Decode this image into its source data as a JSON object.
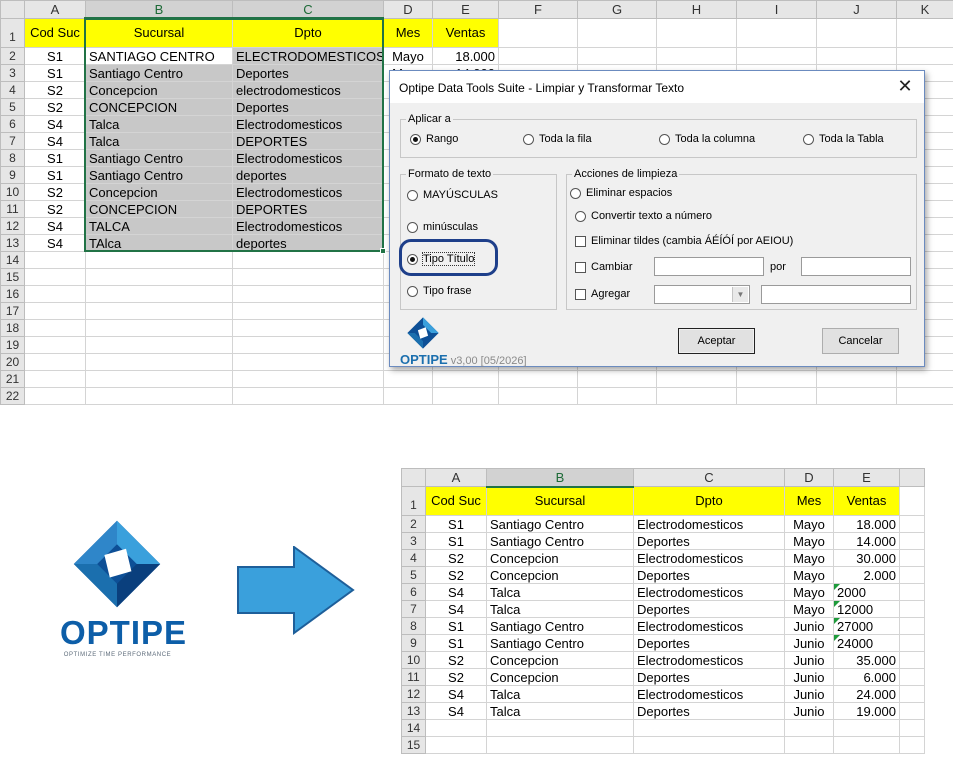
{
  "top_sheet": {
    "columns": [
      "A",
      "B",
      "C",
      "D",
      "E",
      "F",
      "G",
      "H",
      "I",
      "J",
      "K"
    ],
    "headers": [
      "Cod Suc",
      "Sucursal",
      "Dpto",
      "Mes",
      "Ventas"
    ],
    "rows": [
      {
        "n": "2",
        "suc": "S1",
        "sucursal": "SANTIAGO CENTRO",
        "dpto": "ELECTRODOMESTICOS",
        "mes": "Mayo",
        "ventas": "18.000"
      },
      {
        "n": "3",
        "suc": "S1",
        "sucursal": "Santiago Centro",
        "dpto": "Deportes",
        "mes": "Mayo",
        "ventas": "14.000"
      },
      {
        "n": "4",
        "suc": "S2",
        "sucursal": "Concepcion",
        "dpto": "electrodomesticos",
        "mes": "",
        "ventas": ""
      },
      {
        "n": "5",
        "suc": "S2",
        "sucursal": "CONCEPCION",
        "dpto": "Deportes",
        "mes": "",
        "ventas": ""
      },
      {
        "n": "6",
        "suc": "S4",
        "sucursal": "Talca",
        "dpto": "Electrodomesticos",
        "mes": "",
        "ventas": ""
      },
      {
        "n": "7",
        "suc": "S4",
        "sucursal": "Talca",
        "dpto": "DEPORTES",
        "mes": "",
        "ventas": ""
      },
      {
        "n": "8",
        "suc": "S1",
        "sucursal": "Santiago Centro",
        "dpto": "Electrodomesticos",
        "mes": "",
        "ventas": ""
      },
      {
        "n": "9",
        "suc": "S1",
        "sucursal": "Santiago Centro",
        "dpto": "deportes",
        "mes": "",
        "ventas": ""
      },
      {
        "n": "10",
        "suc": "S2",
        "sucursal": "Concepcion",
        "dpto": "Electrodomesticos",
        "mes": "",
        "ventas": ""
      },
      {
        "n": "11",
        "suc": "S2",
        "sucursal": "CONCEPCION",
        "dpto": "DEPORTES",
        "mes": "",
        "ventas": ""
      },
      {
        "n": "12",
        "suc": "S4",
        "sucursal": "TALCA",
        "dpto": "Electrodomesticos",
        "mes": "",
        "ventas": ""
      },
      {
        "n": "13",
        "suc": "S4",
        "sucursal": "TAlca",
        "dpto": "deportes",
        "mes": "",
        "ventas": ""
      }
    ],
    "empty_rows": [
      "14",
      "15",
      "16",
      "17",
      "18",
      "19",
      "20",
      "21",
      "22"
    ]
  },
  "dialog": {
    "title": "Optipe Data Tools Suite - Limpiar y Transformar Texto",
    "close": "✕",
    "aplicar": {
      "legend": "Aplicar a",
      "options": [
        "Rango",
        "Toda la fila",
        "Toda la columna",
        "Toda la Tabla"
      ],
      "selected": "Rango"
    },
    "formato": {
      "legend": "Formato de texto",
      "options": [
        "MAYÚSCULAS",
        "minúsculas",
        "Tipo Título",
        "Tipo frase"
      ],
      "selected": "Tipo Título"
    },
    "acciones": {
      "legend": "Acciones de limpieza",
      "eliminar_espacios": "Eliminar espacios",
      "convertir": "Convertir texto a número",
      "eliminar_tildes": "Eliminar tildes (cambia ÁÉÍÓÍ por AEIOU)",
      "cambiar": "Cambiar",
      "por": "por",
      "agregar": "Agregar"
    },
    "aceptar": "Aceptar",
    "cancelar": "Cancelar",
    "brand": "OPTIPE",
    "version": "v3,00 [05/2026]"
  },
  "logo": {
    "name": "OPTIPE",
    "tagline": "OPTIMIZE TIME PERFORMANCE",
    "colors": {
      "blue_dark": "#0d4f96",
      "blue_light": "#3aa0dc"
    }
  },
  "arrow_color": "#3aa0dc",
  "result_sheet": {
    "columns": [
      "A",
      "B",
      "C",
      "D",
      "E"
    ],
    "headers": [
      "Cod Suc",
      "Sucursal",
      "Dpto",
      "Mes",
      "Ventas"
    ],
    "rows": [
      {
        "n": "2",
        "suc": "S1",
        "sucursal": "Santiago Centro",
        "dpto": "Electrodomesticos",
        "mes": "Mayo",
        "ventas": "18.000",
        "text_num": false
      },
      {
        "n": "3",
        "suc": "S1",
        "sucursal": "Santiago Centro",
        "dpto": "Deportes",
        "mes": "Mayo",
        "ventas": "14.000",
        "text_num": false
      },
      {
        "n": "4",
        "suc": "S2",
        "sucursal": "Concepcion",
        "dpto": "Electrodomesticos",
        "mes": "Mayo",
        "ventas": "30.000",
        "text_num": false
      },
      {
        "n": "5",
        "suc": "S2",
        "sucursal": "Concepcion",
        "dpto": "Deportes",
        "mes": "Mayo",
        "ventas": "2.000",
        "text_num": false
      },
      {
        "n": "6",
        "suc": "S4",
        "sucursal": "Talca",
        "dpto": "Electrodomesticos",
        "mes": "Mayo",
        "ventas": "2000",
        "text_num": true
      },
      {
        "n": "7",
        "suc": "S4",
        "sucursal": "Talca",
        "dpto": "Deportes",
        "mes": "Mayo",
        "ventas": "12000",
        "text_num": true
      },
      {
        "n": "8",
        "suc": "S1",
        "sucursal": "Santiago Centro",
        "dpto": "Electrodomesticos",
        "mes": "Junio",
        "ventas": "27000",
        "text_num": true
      },
      {
        "n": "9",
        "suc": "S1",
        "sucursal": "Santiago Centro",
        "dpto": "Deportes",
        "mes": "Junio",
        "ventas": "24000",
        "text_num": true
      },
      {
        "n": "10",
        "suc": "S2",
        "sucursal": "Concepcion",
        "dpto": "Electrodomesticos",
        "mes": "Junio",
        "ventas": "35.000",
        "text_num": false
      },
      {
        "n": "11",
        "suc": "S2",
        "sucursal": "Concepcion",
        "dpto": "Deportes",
        "mes": "Junio",
        "ventas": "6.000",
        "text_num": false
      },
      {
        "n": "12",
        "suc": "S4",
        "sucursal": "Talca",
        "dpto": "Electrodomesticos",
        "mes": "Junio",
        "ventas": "24.000",
        "text_num": false
      },
      {
        "n": "13",
        "suc": "S4",
        "sucursal": "Talca",
        "dpto": "Deportes",
        "mes": "Junio",
        "ventas": "19.000",
        "text_num": false
      }
    ],
    "empty_rows": [
      "14",
      "15"
    ]
  }
}
